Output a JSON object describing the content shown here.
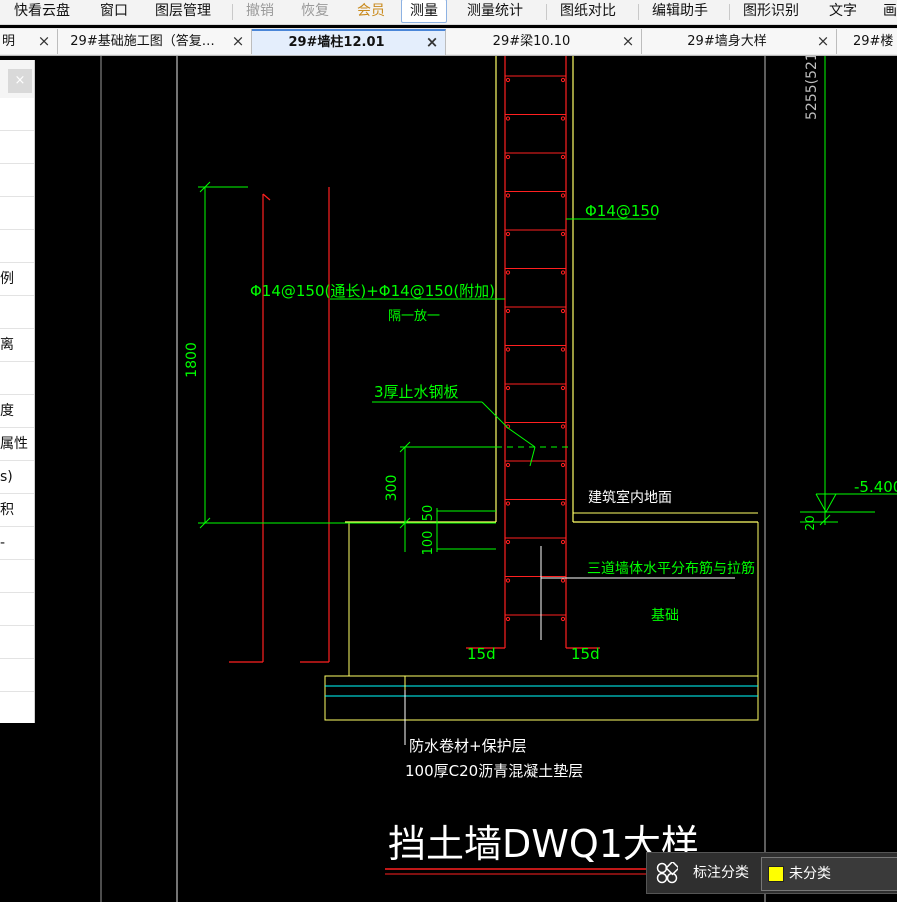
{
  "menubar": {
    "items": [
      "快看云盘",
      "窗口",
      "图层管理",
      "撤销",
      "恢复",
      "会员",
      "测量",
      "测量统计",
      "图纸对比",
      "编辑助手",
      "图形识别",
      "文字",
      "画"
    ]
  },
  "tabs": [
    {
      "label": "明"
    },
    {
      "label": "29#基础施工图（答复…"
    },
    {
      "label": "29#墙柱12.01"
    },
    {
      "label": "29#梁10.10"
    },
    {
      "label": "29#墙身大样"
    },
    {
      "label": "29#楼"
    }
  ],
  "left_panel": {
    "rows": [
      "",
      "",
      "",
      "",
      "",
      "例",
      "",
      "离",
      "",
      "度",
      "属性",
      "s)",
      "积",
      "‐",
      "",
      "",
      "",
      "",
      ""
    ]
  },
  "drawing": {
    "dim_top_right": "5255(521",
    "rebar_right": "Φ14@150",
    "rebar_left": "Φ14@150(通长)+Φ14@150(附加)",
    "rebar_left_sub": "隔一放一",
    "dim_1800": "1800",
    "steel_plate": "3厚止水钢板",
    "dim_300": "300",
    "floor_label": "建筑室内地面",
    "elev": "-5.400",
    "dim_20": "20",
    "dim_50": "50",
    "dim_100": "100",
    "wall_rebar_note": "三道墙体水平分布筋与拉筋",
    "foundation": "基础",
    "anchor_left": "15d",
    "anchor_right": "15d",
    "waterproof": "防水卷材+保护层",
    "cushion": "100厚C20沥青混凝土垫层",
    "title": "挡土墙DWQ1大样",
    "colors": {
      "green": "#00ff00",
      "red": "#ff2020",
      "yellow": "#ffff66",
      "white": "#ffffff",
      "cyan": "#00ffff",
      "grey": "#bfbfbf"
    }
  },
  "annotation_bar": {
    "icon": "annotation-category-icon",
    "label": "标注分类",
    "value": "未分类",
    "swatch_color": "#ffff00"
  }
}
